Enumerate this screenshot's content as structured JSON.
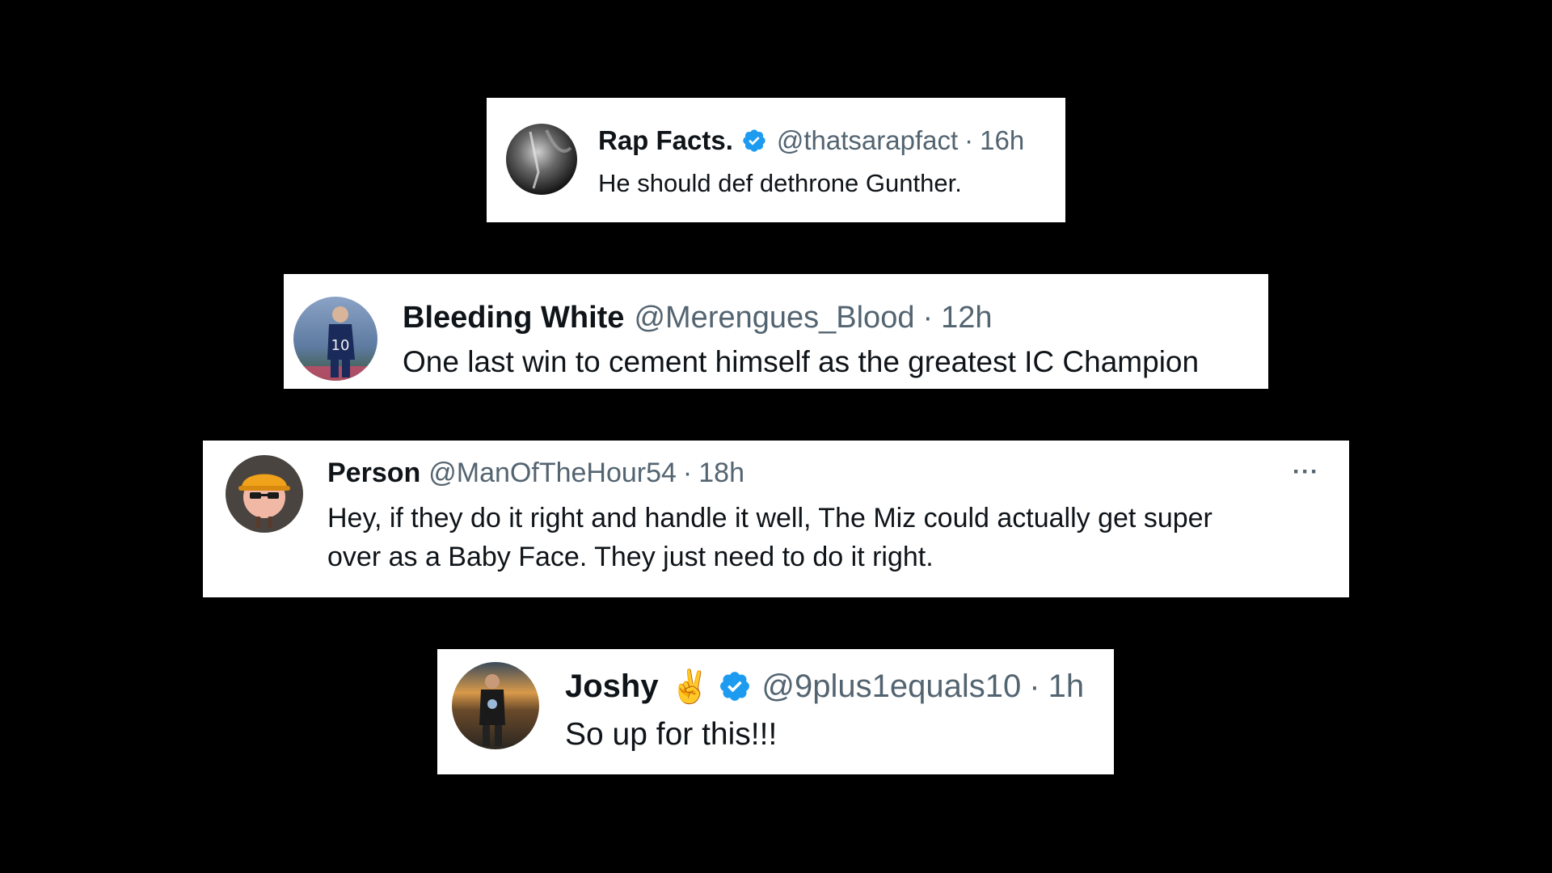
{
  "accent_verified": "#1d9bf0",
  "tweets": [
    {
      "name": "Rap Facts.",
      "verified": true,
      "handle": "@thatsarapfact",
      "separator": "·",
      "time": "16h",
      "text": [
        "He should def dethrone Gunther."
      ],
      "avatar_icon": "dark-smoke-avatar"
    },
    {
      "name": "Bleeding White",
      "verified": false,
      "handle": "@Merengues_Blood",
      "separator": "·",
      "time": "12h",
      "text": [
        "One last win to cement himself as the greatest IC Champion"
      ],
      "avatar_icon": "footballer-avatar"
    },
    {
      "name": "Person",
      "verified": false,
      "handle": "@ManOfTheHour54",
      "separator": "·",
      "time": "18h",
      "text": [
        "Hey, if they do it right and handle it well, The Miz could actually get super",
        "over as a Baby Face. They just need to do it right."
      ],
      "more_label": "···",
      "avatar_icon": "cartoon-hardhat-avatar"
    },
    {
      "name": "Joshy",
      "emoji": "✌️",
      "verified": true,
      "handle": "@9plus1equals10",
      "separator": "·",
      "time": "1h",
      "text": [
        "So up for this!!!"
      ],
      "avatar_icon": "sunset-person-avatar"
    }
  ]
}
